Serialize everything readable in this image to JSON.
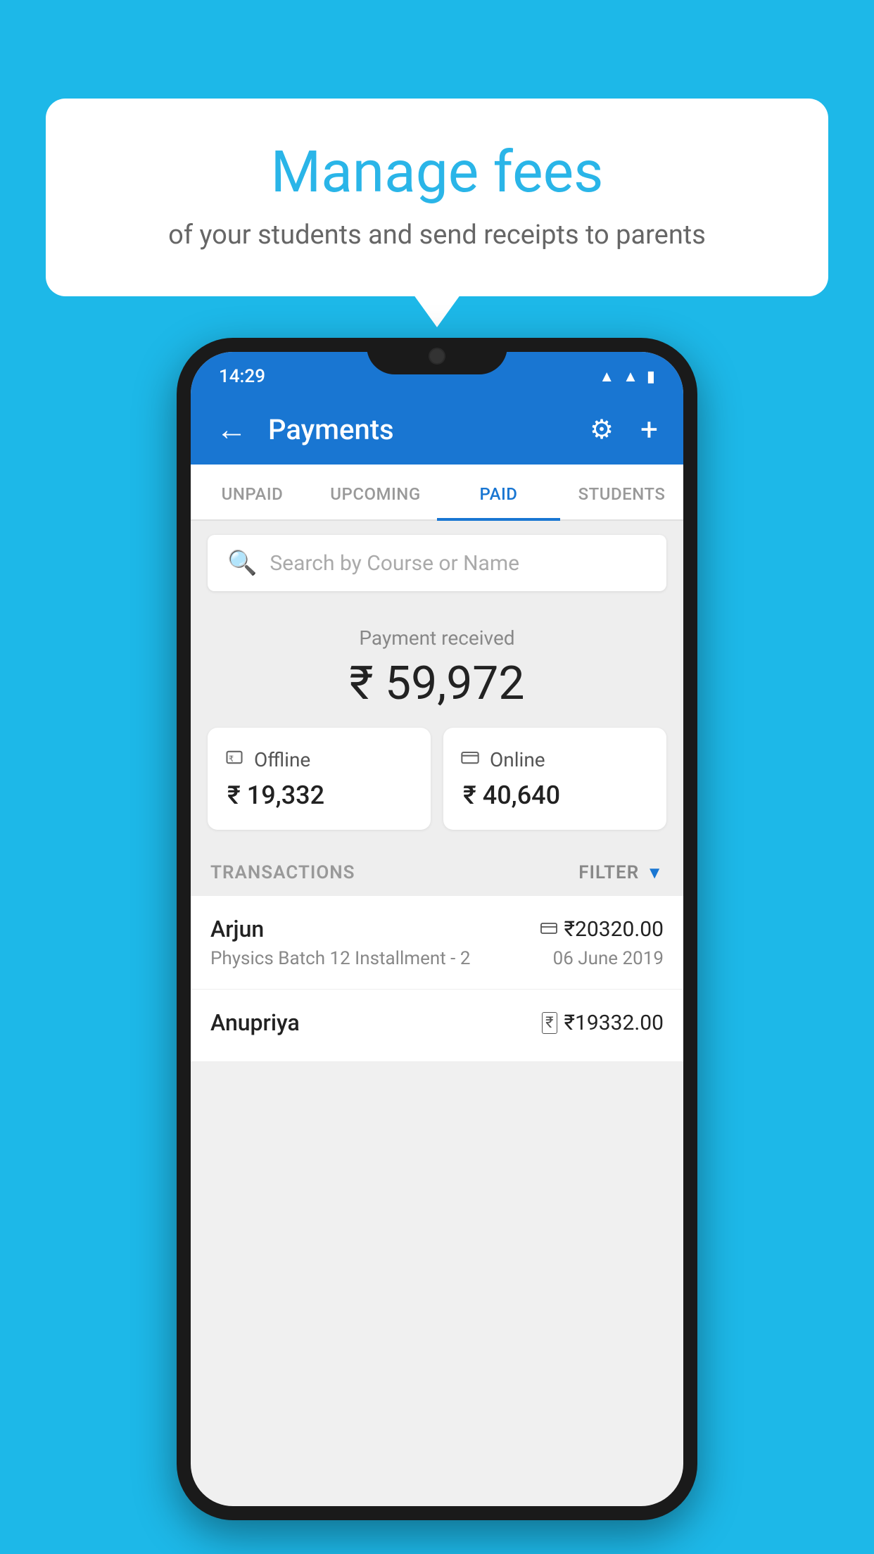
{
  "background_color": "#1DB8E8",
  "bubble": {
    "title": "Manage fees",
    "subtitle": "of your students and send receipts to parents"
  },
  "status_bar": {
    "time": "14:29",
    "icons": [
      "wifi",
      "signal",
      "battery"
    ]
  },
  "app_bar": {
    "title": "Payments",
    "back_label": "←",
    "gear_label": "⚙",
    "plus_label": "+"
  },
  "tabs": [
    {
      "id": "unpaid",
      "label": "UNPAID",
      "active": false
    },
    {
      "id": "upcoming",
      "label": "UPCOMING",
      "active": false
    },
    {
      "id": "paid",
      "label": "PAID",
      "active": true
    },
    {
      "id": "students",
      "label": "STUDENTS",
      "active": false
    }
  ],
  "search": {
    "placeholder": "Search by Course or Name"
  },
  "payment_received": {
    "label": "Payment received",
    "amount": "₹ 59,972",
    "offline": {
      "label": "Offline",
      "amount": "₹ 19,332"
    },
    "online": {
      "label": "Online",
      "amount": "₹ 40,640"
    }
  },
  "transactions_section": {
    "label": "TRANSACTIONS",
    "filter_label": "FILTER"
  },
  "transactions": [
    {
      "name": "Arjun",
      "amount": "₹20320.00",
      "course": "Physics Batch 12 Installment - 2",
      "date": "06 June 2019",
      "payment_type": "card"
    },
    {
      "name": "Anupriya",
      "amount": "₹19332.00",
      "course": "",
      "date": "",
      "payment_type": "rupee"
    }
  ]
}
